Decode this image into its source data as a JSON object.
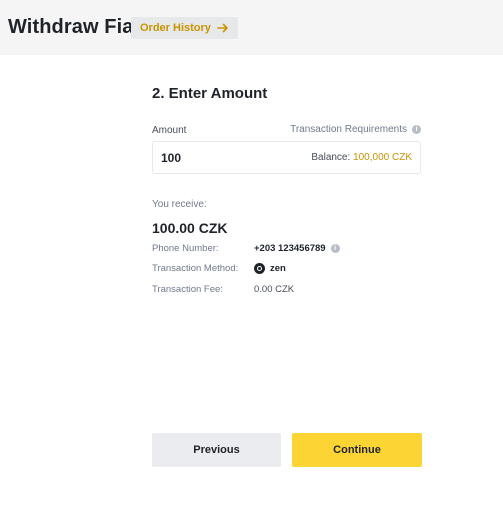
{
  "header": {
    "title": "Withdraw Fiat",
    "order_history_label": "Order History",
    "order_history_icon": "arrow-right-icon"
  },
  "form": {
    "step_title": "2. Enter Amount",
    "amount_label": "Amount",
    "requirements_label": "Transaction Requirements",
    "amount_value": "100",
    "balance_label": "Balance:",
    "balance_value": "100,000 CZK"
  },
  "summary": {
    "you_receive_label": "You receive:",
    "receive_amount": "100.00 CZK",
    "phone_label": "Phone Number:",
    "phone_value": "+203 123456789",
    "method_label": "Transaction Method:",
    "method_value": "zen",
    "fee_label": "Transaction Fee:",
    "fee_value": "0.00 CZK"
  },
  "actions": {
    "previous_label": "Previous",
    "continue_label": "Continue"
  },
  "colors": {
    "accent": "#fcd535",
    "link": "#c99400",
    "topbar": "#f5f5f5"
  }
}
